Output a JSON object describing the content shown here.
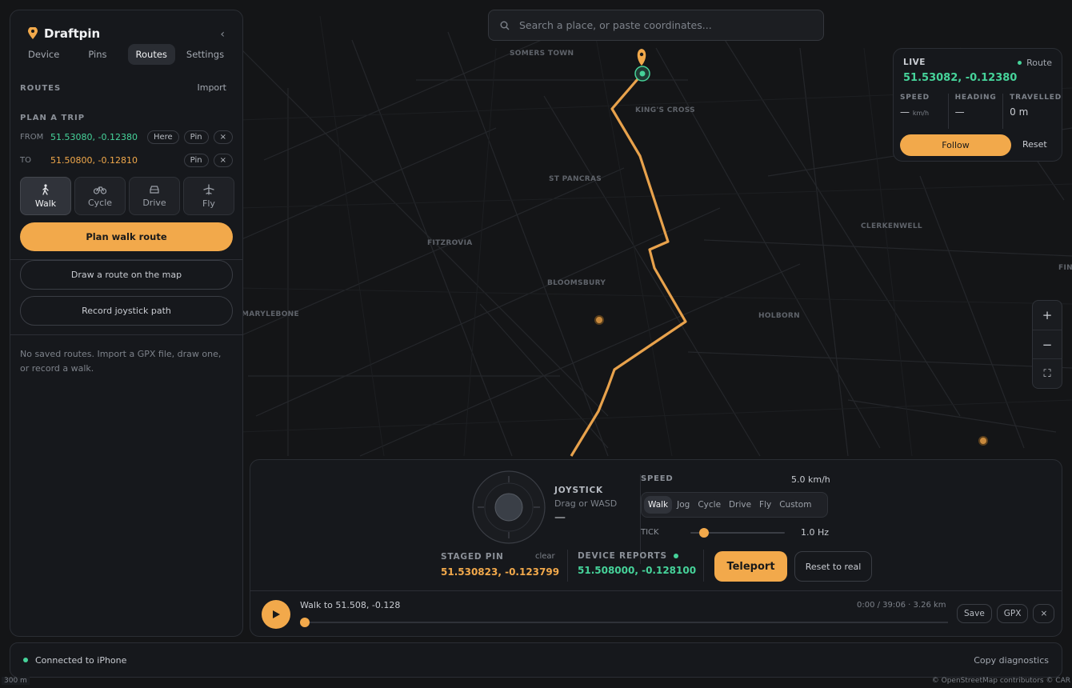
{
  "app": {
    "name": "Draftpin",
    "collapse_glyph": "‹"
  },
  "tabs": [
    "Device",
    "Pins",
    "Routes",
    "Settings"
  ],
  "routes": {
    "heading": "ROUTES",
    "import_label": "Import",
    "plan_heading": "PLAN A TRIP",
    "from_label": "FROM",
    "from_value": "51.53080, -0.12380",
    "to_label": "TO",
    "to_value": "51.50800, -0.12810",
    "here_label": "Here",
    "pin_label": "Pin",
    "clear_glyph": "×",
    "modes": [
      "Walk",
      "Cycle",
      "Drive",
      "Fly"
    ],
    "plan_button": "Plan walk route",
    "draw_button": "Draw a route on the map",
    "record_button": "Record joystick path",
    "empty_text": "No saved routes. Import a GPX file, draw one, or record a walk."
  },
  "search": {
    "placeholder": "Search a place, or paste coordinates..."
  },
  "live": {
    "label": "LIVE",
    "route_label": "Route",
    "coords": "51.53082, -0.12380",
    "speed_label": "SPEED",
    "speed_value": "—",
    "speed_unit": "km/h",
    "heading_label": "HEADING",
    "heading_value": "—",
    "travelled_label": "TRAVELLED",
    "travelled_value": "0 m",
    "follow_label": "Follow",
    "reset_label": "Reset"
  },
  "zoom": {
    "in": "+",
    "out": "−",
    "fullscreen": "⛶"
  },
  "map_labels": [
    "SOMERS TOWN",
    "KING'S CROSS",
    "ST PANCRAS",
    "FITZROVIA",
    "BLOOMSBURY",
    "MARYLEBONE",
    "HOLBORN",
    "CLERKENWELL",
    "FIN"
  ],
  "joystick": {
    "title": "JOYSTICK",
    "hint": "Drag or WASD",
    "value": "—",
    "speed_label": "SPEED",
    "speed_value": "5.0 km/h",
    "speed_modes": [
      "Walk",
      "Jog",
      "Cycle",
      "Drive",
      "Fly",
      "Custom"
    ],
    "tick_label": "TICK",
    "tick_value": "1.0 Hz",
    "tick_fraction": 0.14
  },
  "staged": {
    "label": "STAGED PIN",
    "clear_label": "clear",
    "value": "51.530823, -0.123799"
  },
  "device": {
    "label": "DEVICE REPORTS",
    "value": "51.508000, -0.128100"
  },
  "teleport_label": "Teleport",
  "reset_real_label": "Reset to real",
  "playback": {
    "title": "Walk to 51.508, -0.128",
    "time": "0:00 / 39:06 · 3.26 km",
    "progress": 0,
    "save_label": "Save",
    "gpx_label": "GPX",
    "close_glyph": "×"
  },
  "status": {
    "connected": "Connected to iPhone",
    "diagnostics": "Copy diagnostics"
  },
  "footer": {
    "scale": "300 m",
    "attribution": "© OpenStreetMap contributors © CAR"
  },
  "colors": {
    "accent": "#f2a94b",
    "green": "#46d39a",
    "route": "#e8a24c"
  }
}
